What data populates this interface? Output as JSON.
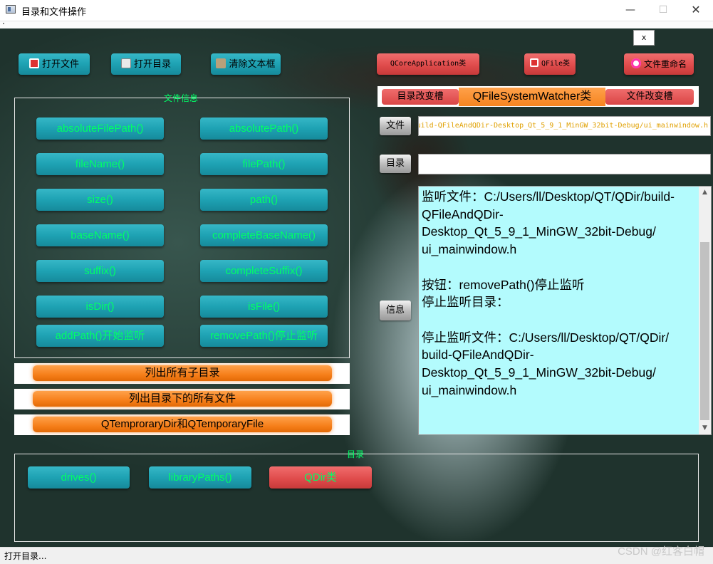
{
  "window": {
    "title": "目录和文件操作",
    "min": "—",
    "max": "☐",
    "close": "✕"
  },
  "close_small": "x",
  "toolbar": {
    "open_file": "打开文件",
    "open_dir": "打开目录",
    "clear_text": "清除文本框",
    "qcore": "QCoreApplication类",
    "qfile": "QFile类",
    "rename": "文件重命名"
  },
  "file_info": {
    "legend": "文件信息",
    "buttons": [
      "absoluteFilePath()",
      "absolutePath()",
      "fileName()",
      "filePath()",
      "size()",
      "path()",
      "baseName()",
      "completeBaseName()",
      "suffix()",
      "completeSuffix()",
      "isDir()",
      "isFile()",
      "addPath()开始监听",
      "removePath()停止监听"
    ]
  },
  "orange_buttons": [
    "列出所有子目录",
    "列出目录下的所有文件",
    "QTemproraryDir和QTemporaryFile"
  ],
  "dir_group": {
    "legend": "目录",
    "drives": "drives()",
    "library_paths": "libraryPaths()",
    "qdir": "QDir类"
  },
  "watcher": {
    "left": "目录改变槽",
    "mid": "QFileSystemWatcher类",
    "right": "文件改变槽"
  },
  "labels": {
    "file": "文件",
    "dir": "目录",
    "info": "信息"
  },
  "file_field": {
    "value": "uild-QFileAndQDir-Desktop_Qt_5_9_1_MinGW_32bit-Debug/ui_mainwindow.h"
  },
  "dir_field": {
    "value": ""
  },
  "info_text": "监听文件：C:/Users/ll/Desktop/QT/QDir/build-\nQFileAndQDir-\nDesktop_Qt_5_9_1_MinGW_32bit-Debug/\nui_mainwindow.h\n\n按钮：removePath()停止监听\n停止监听目录：\n\n停止监听文件：C:/Users/ll/Desktop/QT/QDir/\nbuild-QFileAndQDir-\nDesktop_Qt_5_9_1_MinGW_32bit-Debug/\nui_mainwindow.h",
  "status": "打开目录...",
  "watermark": "CSDN @红客白帽",
  "colors": {
    "teal": "#1ea2b3",
    "green_text": "#00ff66",
    "red": "#e04c4c",
    "orange": "#f67f1a",
    "info_bg": "#b3fbfd"
  }
}
